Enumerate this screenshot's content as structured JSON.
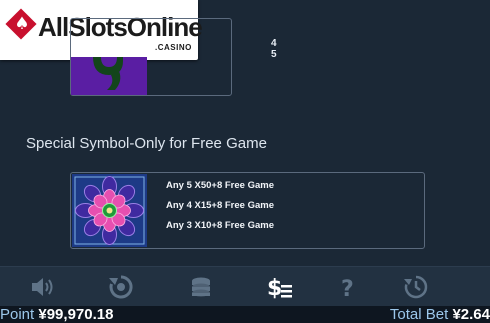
{
  "watermark": {
    "text": "AllSlotsOnline",
    "sub": ".CASINO"
  },
  "top_panel": {
    "pays": [
      "4",
      "5"
    ]
  },
  "special_title": "Special Symbol-Only for Free Game",
  "special_pays": [
    "Any 5  X50+8 Free Game",
    "Any 4  X15+8 Free Game",
    "Any 3  X10+8 Free Game"
  ],
  "toolbar": {
    "icons": [
      "sound-icon",
      "autoplay-icon",
      "coins-icon",
      "paytable-icon",
      "help-icon",
      "history-icon"
    ],
    "active": "paytable-icon",
    "active_color": "#ffffff",
    "inactive_color": "#5f7387"
  },
  "status": {
    "point_label": "Point",
    "point_value": "¥99,970.18",
    "bet_label": "Total Bet",
    "bet_value": "¥2.64",
    "label_color": "#9cc7ea"
  }
}
